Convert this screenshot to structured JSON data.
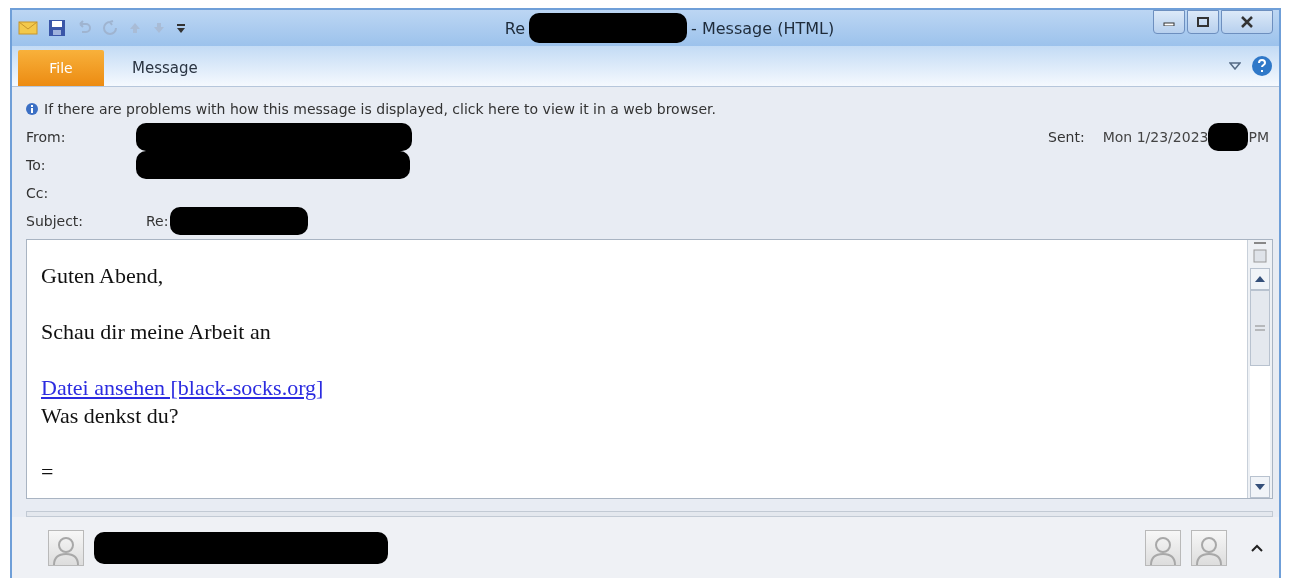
{
  "window": {
    "title_prefix": "Re",
    "title_suffix": "- Message (HTML)"
  },
  "tabs": [
    {
      "label": "File",
      "kind": "file"
    },
    {
      "label": "Message",
      "kind": "tab"
    }
  ],
  "info_bar": "If there are problems with how this message is displayed, click here to view it in a web browser.",
  "header": {
    "fields": [
      {
        "label": "From:",
        "kind": "redacted"
      },
      {
        "label": "To:",
        "kind": "redacted"
      },
      {
        "label": "Cc:",
        "kind": "empty"
      },
      {
        "label": "Subject:",
        "kind": "subject",
        "prefix": "Re:"
      }
    ],
    "sent": {
      "label": "Sent:",
      "date": "Mon 1/23/2023",
      "suffix": "PM"
    }
  },
  "body": {
    "paragraphs": [
      [
        {
          "kind": "text",
          "text": "Guten Abend,"
        }
      ],
      [
        {
          "kind": "text",
          "text": "Schau dir meine Arbeit an"
        }
      ],
      [
        {
          "kind": "link",
          "text": "Datei ansehen [black-socks.org]"
        },
        {
          "kind": "text",
          "text": "Was denkst du?"
        }
      ],
      [
        {
          "kind": "text",
          "text": "="
        }
      ]
    ]
  }
}
